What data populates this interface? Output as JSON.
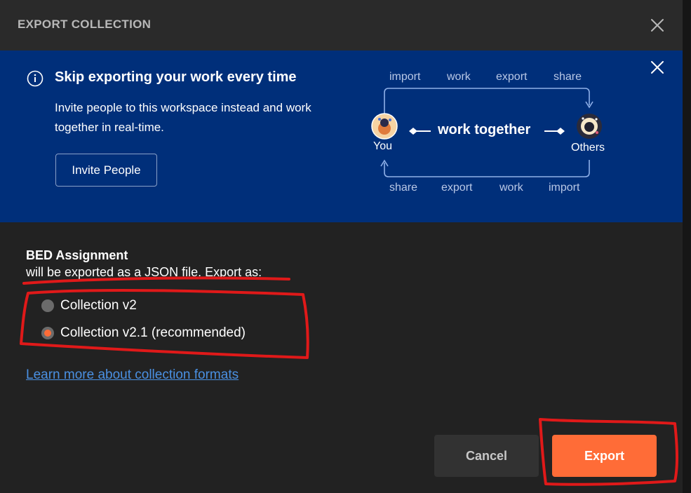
{
  "modal": {
    "title": "EXPORT COLLECTION"
  },
  "banner": {
    "title": "Skip exporting your work every time",
    "description": "Invite people to this workspace instead and work together in real-time.",
    "invite_button": "Invite People",
    "diagram": {
      "top_labels": [
        "import",
        "work",
        "export",
        "share"
      ],
      "bottom_labels": [
        "share",
        "export",
        "work",
        "import"
      ],
      "center": "work together",
      "left_avatar": "You",
      "right_avatar": "Others"
    }
  },
  "export": {
    "collection_name": "BED Assignment",
    "description": "will be exported as a JSON file. Export as:",
    "options": [
      {
        "label": "Collection v2",
        "checked": false
      },
      {
        "label": "Collection v2.1 (recommended)",
        "checked": true
      }
    ],
    "learn_link": "Learn more about collection formats"
  },
  "footer": {
    "cancel_label": "Cancel",
    "export_label": "Export"
  },
  "colors": {
    "accent": "#ff6c37",
    "banner_bg": "#002f7a",
    "link": "#4a90e2",
    "annotation": "#e01919"
  },
  "icons": [
    "close-icon",
    "banner-close-icon",
    "info-icon",
    "you-avatar-icon",
    "others-avatar-icon"
  ]
}
